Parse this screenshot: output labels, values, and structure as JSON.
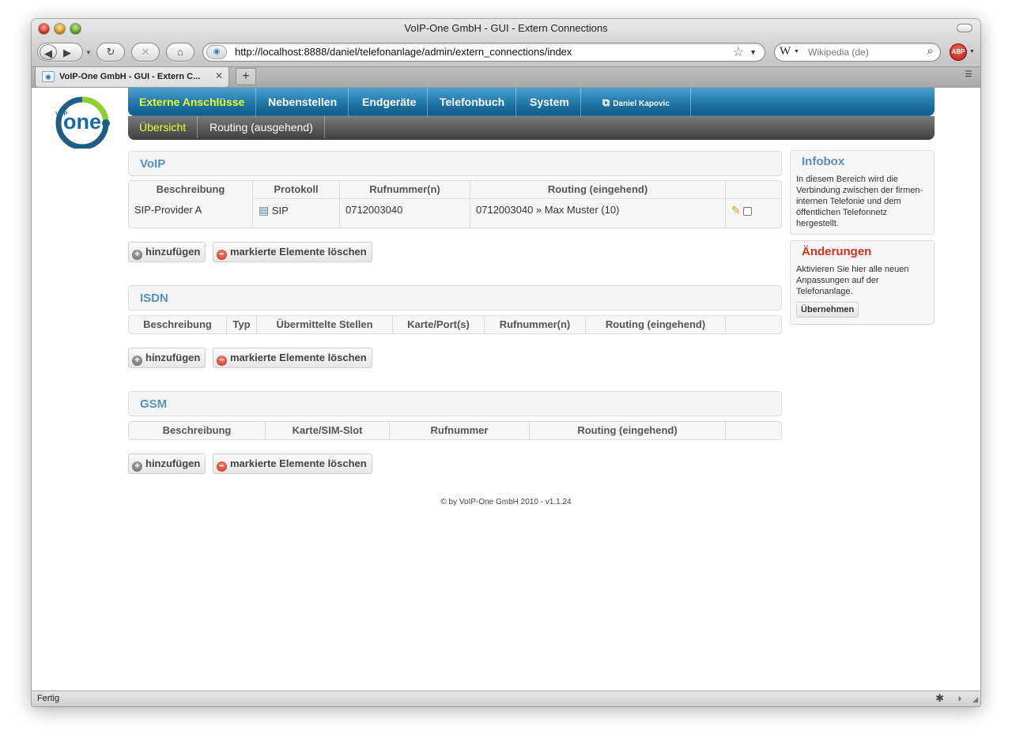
{
  "window": {
    "title": "VoIP-One GmbH - GUI - Extern Connections"
  },
  "toolbar": {
    "url": "http://localhost:8888/daniel/telefonanlage/admin/extern_connections/index",
    "search_placeholder": "Wikipedia (de)",
    "abp_label": "ABP"
  },
  "tabs": [
    {
      "label": "VoIP-One GmbH - GUI - Extern C..."
    }
  ],
  "status": {
    "text": "Fertig"
  },
  "nav": {
    "main": [
      "Externe Anschlüsse",
      "Nebenstellen",
      "Endgeräte",
      "Telefonbuch",
      "System"
    ],
    "user": "Daniel Kapovic",
    "sub": [
      "Übersicht",
      "Routing (ausgehend)"
    ]
  },
  "sections": {
    "voip": {
      "title": "VoIP",
      "columns": [
        "Beschreibung",
        "Protokoll",
        "Rufnummer(n)",
        "Routing (eingehend)"
      ],
      "rows": [
        {
          "beschreibung": "SIP-Provider A",
          "protokoll": "SIP",
          "rufnummer": "0712003040",
          "routing": "0712003040 » Max Muster (10)"
        }
      ]
    },
    "isdn": {
      "title": "ISDN",
      "columns": [
        "Beschreibung",
        "Typ",
        "Übermittelte Stellen",
        "Karte/Port(s)",
        "Rufnummer(n)",
        "Routing (eingehend)"
      ]
    },
    "gsm": {
      "title": "GSM",
      "columns": [
        "Beschreibung",
        "Karte/SIM-Slot",
        "Rufnummer",
        "Routing (eingehend)"
      ]
    }
  },
  "buttons": {
    "add": "hinzufügen",
    "delete": "markierte Elemente löschen"
  },
  "infobox": {
    "title": "Infobox",
    "text": "In diesem Bereich wird die Verbindung zwischen der firmen-internen Telefonie und dem öffentlichen Telefonnetz hergestellt.",
    "title_color": "#5a8fc0"
  },
  "changes": {
    "title": "Änderungen",
    "text": "Aktivieren Sie hier alle neuen Anpassungen auf der Telefonanlage.",
    "button": "Übernehmen",
    "title_color": "#d9301e"
  },
  "footer": "© by VoIP-One GmbH 2010 - v1.1.24",
  "colors": {
    "nav_blue": "#1f76a8",
    "nav_active": "#e6ff2a",
    "section_title": "#5a8fc0"
  },
  "logo": {
    "text": "one",
    "small": "VoIP"
  }
}
